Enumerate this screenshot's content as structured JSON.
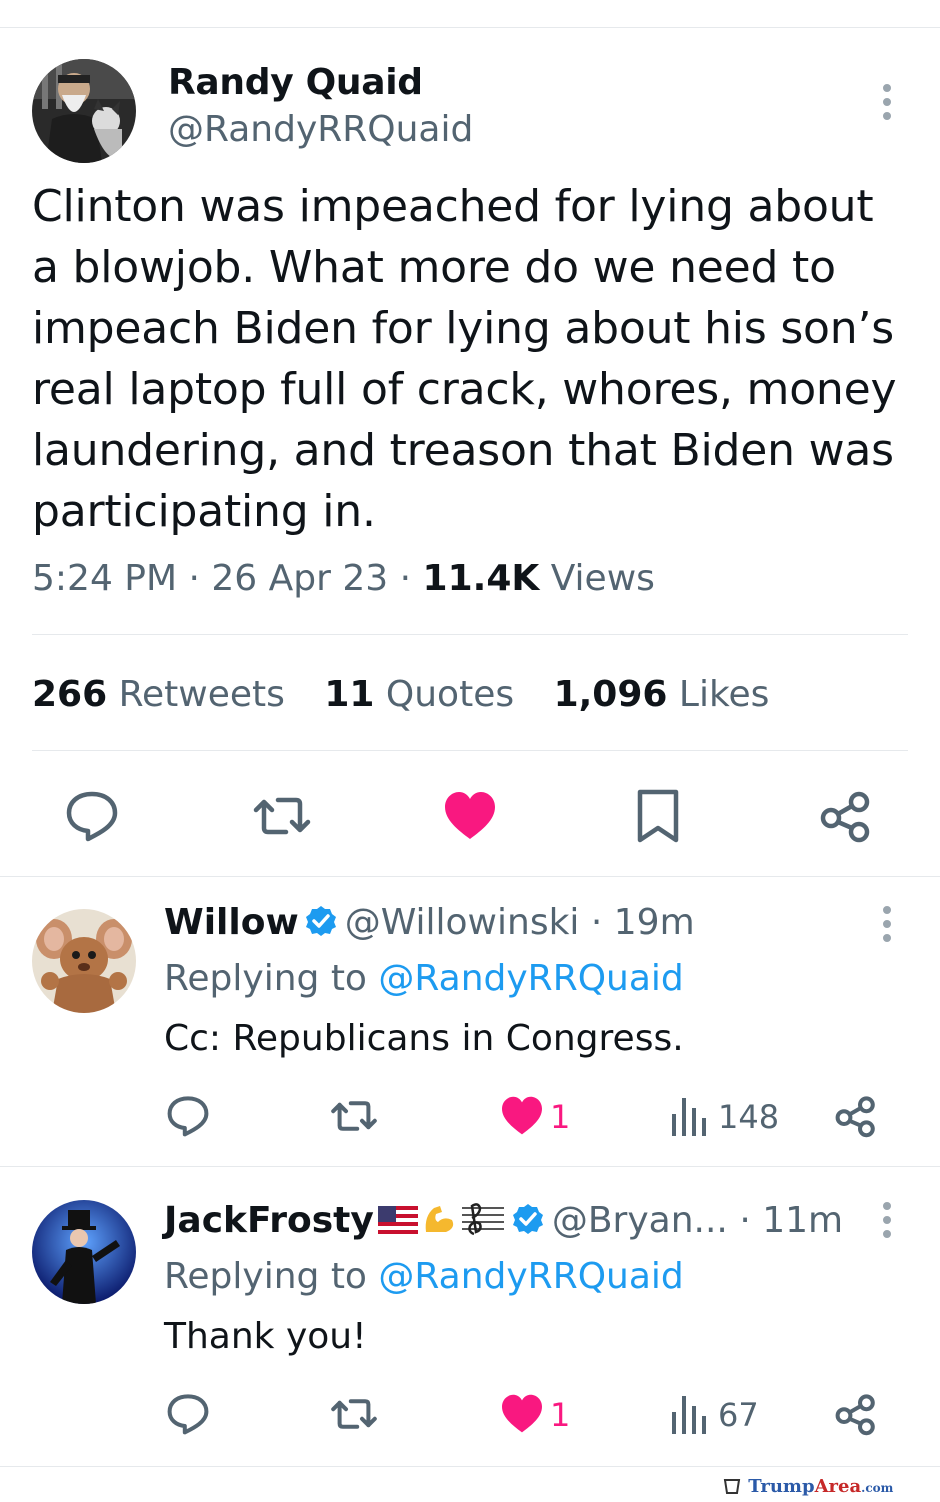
{
  "tweet": {
    "author_name": "Randy Quaid",
    "author_handle": "@RandyRRQuaid",
    "text": "Clinton was impeached for lying about a blowjob. What more do we need to impeach Biden for lying about his son’s real laptop full of crack, whores, money laundering, and treason that Biden was participating in.",
    "time": "5:24 PM",
    "date": "26 Apr 23",
    "views_count": "11.4K",
    "views_label": "Views",
    "retweets_count": "266",
    "retweets_label": "Retweets",
    "quotes_count": "11",
    "quotes_label": "Quotes",
    "likes_count": "1,096",
    "likes_label": "Likes",
    "actions": [
      "reply-icon",
      "retweet-icon",
      "like-icon-filled",
      "bookmark-icon",
      "share-icon"
    ]
  },
  "replies": [
    {
      "name": "Willow",
      "handle": "@Willowinski",
      "time": "19m",
      "replying_prefix": "Replying to",
      "replying_to": "@RandyRRQuaid",
      "text": "Cc: Republicans in Congress.",
      "likes": "1",
      "views": "148"
    },
    {
      "name": "JackFrosty",
      "handle": "@Bryan...",
      "time": "11m",
      "replying_prefix": "Replying to",
      "replying_to": "@RandyRRQuaid",
      "text": "Thank you!",
      "likes": "1",
      "views": "67"
    }
  ],
  "watermark": {
    "part1": "Trump",
    "part2": "Area",
    "part3": ".com"
  },
  "colors": {
    "like": "#f91880",
    "link": "#1d9bf0",
    "secondary": "#536471",
    "icon": "#536471"
  }
}
